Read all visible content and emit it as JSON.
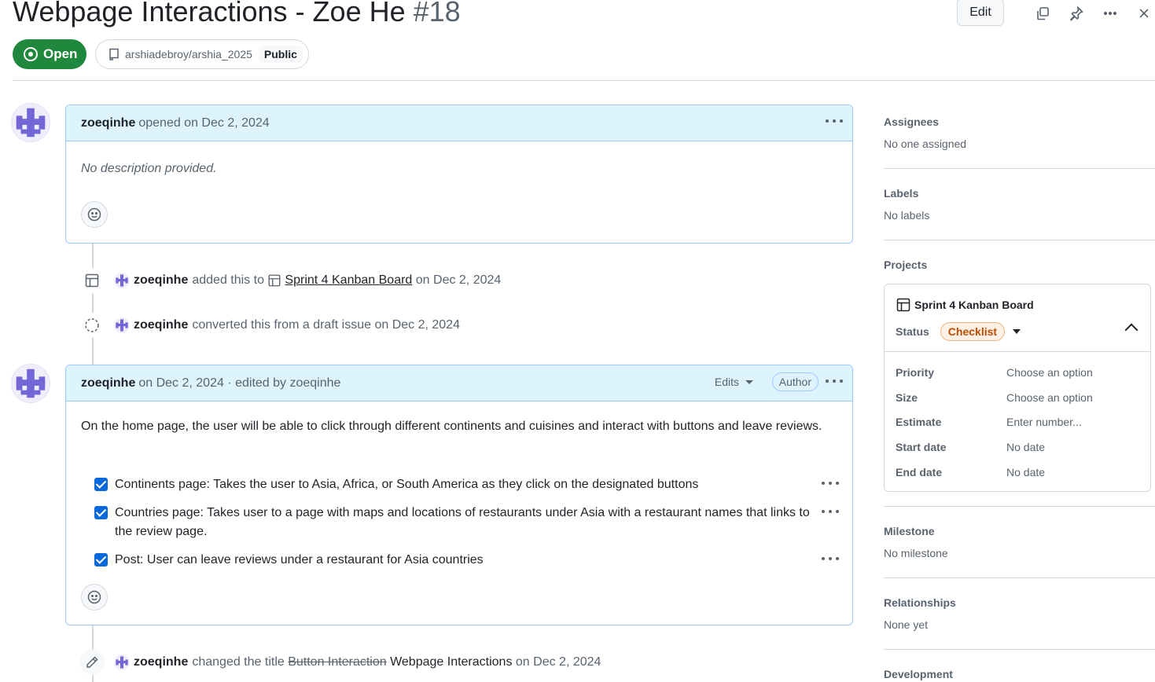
{
  "issue": {
    "title": "Webpage Interactions - Zoe He",
    "number": "#18",
    "state": "Open",
    "repo": "arshiadebroy/arshia_2025",
    "visibility": "Public",
    "edit_label": "Edit"
  },
  "comments": [
    {
      "author": "zoeqinhe",
      "meta": "opened on Dec 2, 2024",
      "body": "No description provided."
    },
    {
      "author": "zoeqinhe",
      "meta": "on Dec 2, 2024 · edited by zoeqinhe",
      "edits_label": "Edits",
      "role_badge": "Author",
      "body": "On the home page, the user will be able to click through different continents and cuisines and interact with buttons and leave reviews.",
      "tasks": [
        {
          "text": "Continents page: Takes the user to Asia, Africa, or South America as they click on the designated buttons",
          "checked": true
        },
        {
          "text": "Countries page: Takes user to a page with maps and locations of restaurants under Asia with a restaurant names that links to the review page.",
          "checked": true
        },
        {
          "text": "Post: User can leave reviews under a restaurant for Asia countries",
          "checked": true
        }
      ]
    }
  ],
  "events": [
    {
      "actor": "zoeqinhe",
      "action": "added this to",
      "target": "Sprint 4 Kanban Board",
      "date": "on Dec 2, 2024"
    },
    {
      "actor": "zoeqinhe",
      "action": "converted this from a draft issue on Dec 2, 2024"
    },
    {
      "actor": "zoeqinhe",
      "action": "changed the title",
      "old_title": "Button Interaction",
      "new_title": "Webpage Interactions",
      "date": "on Dec 2, 2024"
    }
  ],
  "sidebar": {
    "assignees": {
      "title": "Assignees",
      "value": "No one assigned"
    },
    "labels": {
      "title": "Labels",
      "value": "No labels"
    },
    "projects": {
      "title": "Projects",
      "name": "Sprint 4 Kanban Board",
      "status_label": "Status",
      "status_value": "Checklist",
      "status_color": "#bc4c00",
      "fields": [
        {
          "key": "Priority",
          "value": "Choose an option"
        },
        {
          "key": "Size",
          "value": "Choose an option"
        },
        {
          "key": "Estimate",
          "value": "Enter number..."
        },
        {
          "key": "Start date",
          "value": "No date"
        },
        {
          "key": "End date",
          "value": "No date"
        }
      ]
    },
    "milestone": {
      "title": "Milestone",
      "value": "No milestone"
    },
    "relationships": {
      "title": "Relationships",
      "value": "None yet"
    },
    "development": {
      "title": "Development"
    }
  },
  "colors": {
    "open_green": "#1f883d",
    "link_blue": "#0969da",
    "comment_header": "#ddf4ff"
  },
  "icons": [
    "copy-icon",
    "pin-icon",
    "kebab-icon",
    "close-icon",
    "repo-icon",
    "smiley-icon",
    "table-icon",
    "draft-circle-icon",
    "pencil-icon"
  ]
}
